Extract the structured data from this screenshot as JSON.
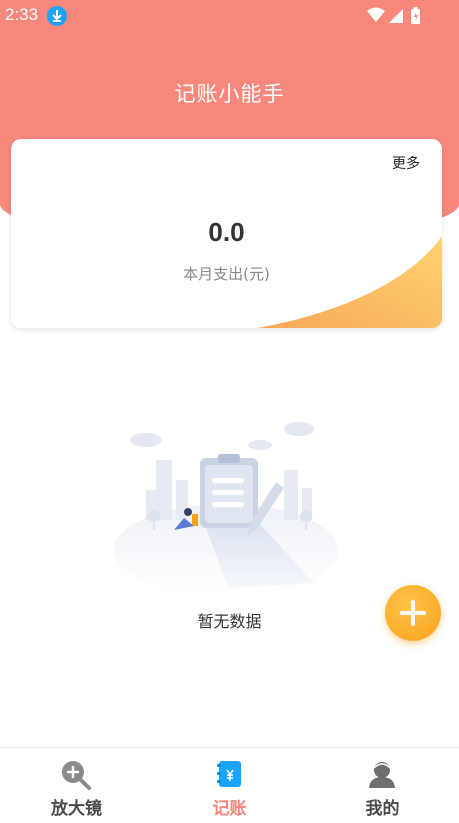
{
  "status_bar": {
    "time": "2:33"
  },
  "header": {
    "title": "记账小能手"
  },
  "summary_card": {
    "more_label": "更多",
    "amount": "0.0",
    "amount_label": "本月支出(元)"
  },
  "empty_state": {
    "text": "暂无数据"
  },
  "fab": {
    "icon": "plus-icon"
  },
  "bottom_nav": {
    "items": [
      {
        "label": "放大镜",
        "icon": "magnifier-icon",
        "active": false
      },
      {
        "label": "记账",
        "icon": "notebook-icon",
        "active": true
      },
      {
        "label": "我的",
        "icon": "user-icon",
        "active": false
      }
    ]
  },
  "colors": {
    "header": "#f8877c",
    "accent": "#f7a21b",
    "active_nav": "#f8877c",
    "inactive_nav": "#4a4a4a"
  }
}
